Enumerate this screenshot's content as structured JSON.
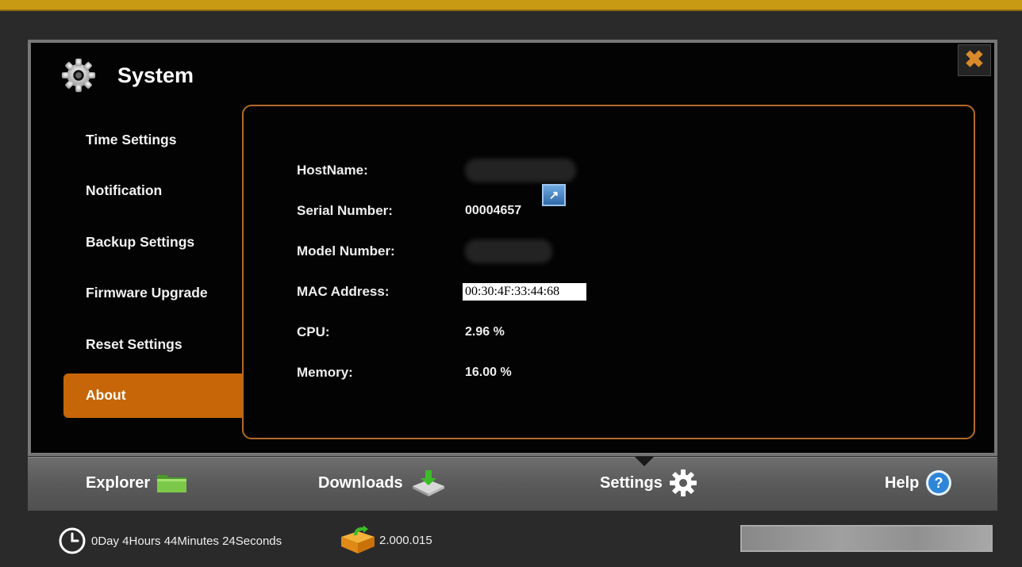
{
  "window": {
    "title": "System",
    "close_icon": "close-icon"
  },
  "sidebar": {
    "items": [
      {
        "label": "Time Settings",
        "active": false
      },
      {
        "label": "Notification",
        "active": false
      },
      {
        "label": "Backup Settings",
        "active": false
      },
      {
        "label": "Firmware Upgrade",
        "active": false
      },
      {
        "label": "Reset Settings",
        "active": false
      },
      {
        "label": "About",
        "active": true
      }
    ]
  },
  "about": {
    "hostname_label": "HostName:",
    "serial_label": "Serial Number:",
    "serial_value": "00004657",
    "model_label": "Model Number:",
    "mac_label": "MAC Address:",
    "mac_value": "00:30:4F:33:44:68",
    "cpu_label": "CPU:",
    "cpu_value": "2.96 %",
    "memory_label": "Memory:",
    "memory_value": "16.00 %"
  },
  "tabs": [
    {
      "label": "Explorer",
      "icon": "folder-icon"
    },
    {
      "label": "Downloads",
      "icon": "download-icon"
    },
    {
      "label": "Settings",
      "icon": "gear-icon",
      "active": true
    },
    {
      "label": "Help",
      "icon": "help-icon"
    }
  ],
  "status": {
    "uptime": "0Day 4Hours 44Minutes 24Seconds",
    "version": "2.000.015",
    "progress": 1.0
  },
  "colors": {
    "accent": "#c66608",
    "top_stripe": "#c89a14",
    "content_border": "#b36a28"
  }
}
